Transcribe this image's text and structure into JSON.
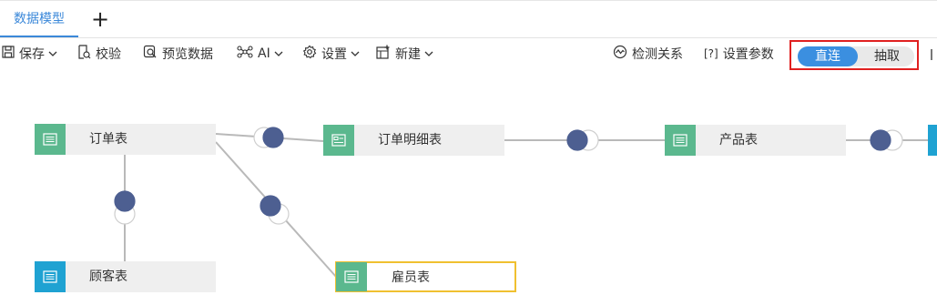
{
  "tabs": {
    "active": "数据模型",
    "add_icon": "plus-icon"
  },
  "toolbar": {
    "save": "保存",
    "validate": "校验",
    "preview": "预览数据",
    "ai": "AI",
    "settings": "设置",
    "new": "新建",
    "detect_relations": "检测关系",
    "set_params_prefix": "[?]",
    "set_params": "设置参数"
  },
  "mode": {
    "direct": "直连",
    "extract": "抽取",
    "selected": "直连"
  },
  "nodes": {
    "orders": "订单表",
    "order_details": "订单明细表",
    "products": "产品表",
    "customers": "顾客表",
    "employees": "雇员表"
  },
  "colors": {
    "accent": "#3b88d9",
    "node_icon_green": "#5bb88e",
    "node_icon_blue": "#1fa2d2",
    "join_dot": "#4d5f91",
    "highlight_border": "#f0c030",
    "mode_box_border": "#e02020"
  }
}
